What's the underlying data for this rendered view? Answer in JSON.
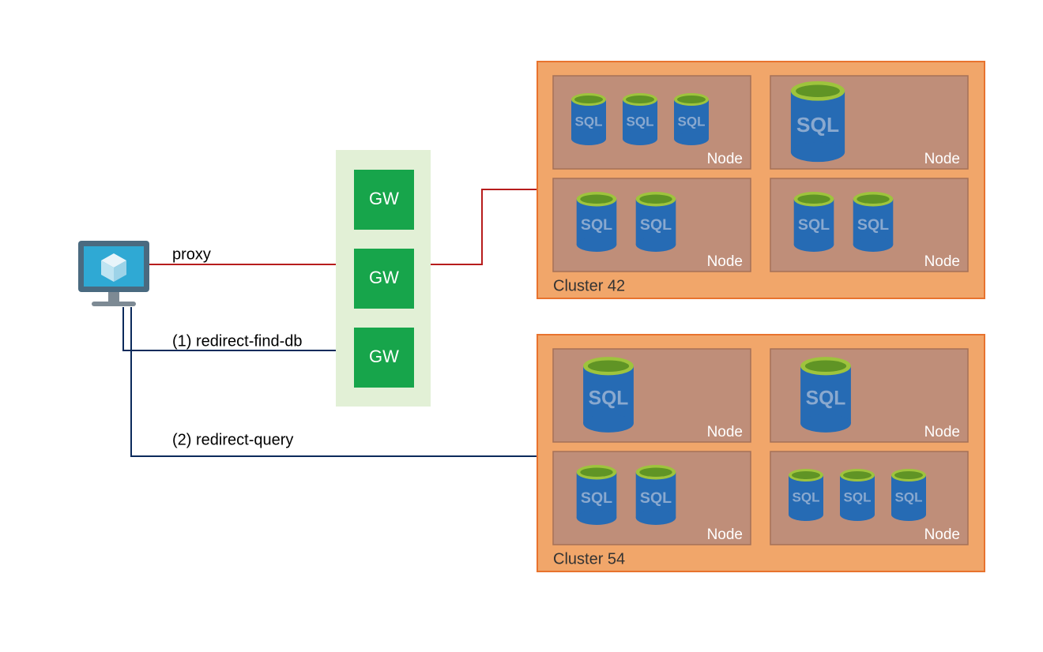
{
  "labels": {
    "proxy": "proxy",
    "redirectFind": "(1) redirect-find-db",
    "redirectQuery": "(2) redirect-query",
    "gw": "GW",
    "sql": "SQL",
    "node": "Node",
    "cluster42": "Cluster 42",
    "cluster54": "Cluster 54"
  },
  "colors": {
    "clusterFill": "#f1a66a",
    "clusterStroke": "#e8732e",
    "nodeFill": "#bf8e79",
    "nodeStroke": "#a57058",
    "gwPanelFill": "#e2f0d6",
    "gwFill": "#17a54b",
    "proxyLine": "#b71c1c",
    "redirectLine": "#0b2a5b",
    "dbBody": "#266bb4",
    "dbTop": "#9ec43d",
    "dbInner": "#609425"
  }
}
